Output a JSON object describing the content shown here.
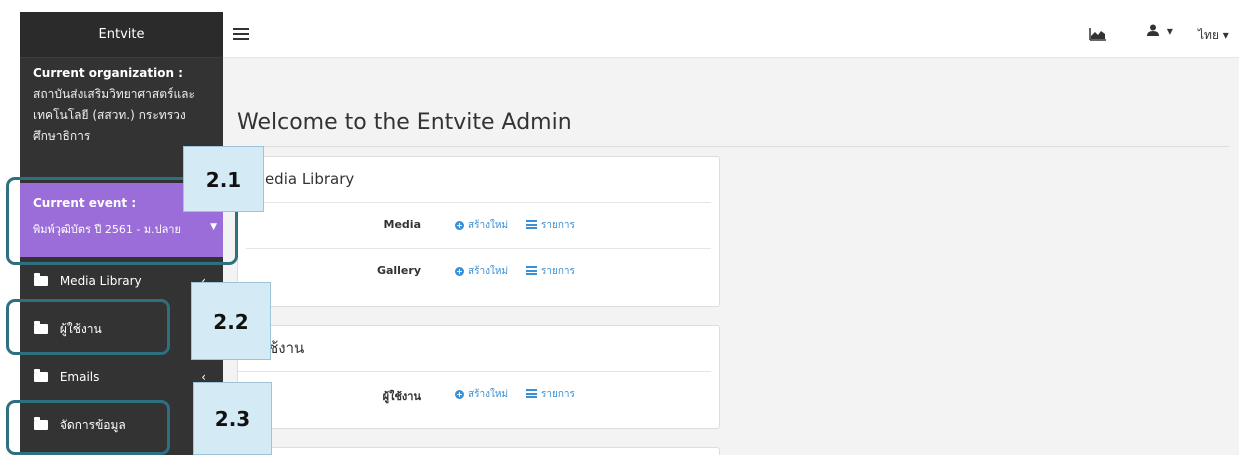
{
  "app": {
    "title": "Entvite"
  },
  "sidebar": {
    "org_label": "Current organization :",
    "org_value": "สถาบันส่งเสริมวิทยาศาสตร์และเทคโนโลยี (สสวท.) กระทรวงศึกษาธิการ",
    "event_label": "Current event :",
    "event_value": "พิมพ์วุฒิบัตร ปี 2561 - ม.ปลาย",
    "items": [
      {
        "label": "Media Library",
        "icon": "folder-icon",
        "has_chevron": true
      },
      {
        "label": "ผู้ใช้งาน",
        "icon": "folder-icon",
        "has_chevron": false
      },
      {
        "label": "Emails",
        "icon": "folder-icon",
        "has_chevron": true
      },
      {
        "label": "จัดการข้อมูล",
        "icon": "folder-icon",
        "has_chevron": false
      }
    ],
    "chevron": "‹"
  },
  "topbar": {
    "menu_icon": "hamburger-icon",
    "chart_icon": "area-chart-icon",
    "user_icon": "user-icon",
    "user_caret": "▾",
    "lang_label": "ไทย ▾"
  },
  "main": {
    "welcome": "Welcome to the Entvite Admin",
    "panels": [
      {
        "title": "Media Library",
        "rows": [
          {
            "name": "Media",
            "new_label": "สร้างใหม่",
            "list_label": "รายการ"
          },
          {
            "name": "Gallery",
            "new_label": "สร้างใหม่",
            "list_label": "รายการ"
          }
        ]
      },
      {
        "title": "ผู้ใช้งาน",
        "rows": [
          {
            "name": "ผู้ใช้งาน",
            "new_label": "สร้างใหม่",
            "list_label": "รายการ"
          }
        ]
      }
    ]
  },
  "callouts": [
    "2.1",
    "2.2",
    "2.3"
  ],
  "colors": {
    "sidebar_bg": "#333333",
    "event_bg": "#9b6dd8",
    "link": "#3a8fd6",
    "callout_bg": "#d4ebf5",
    "ring": "#2e6f80"
  }
}
